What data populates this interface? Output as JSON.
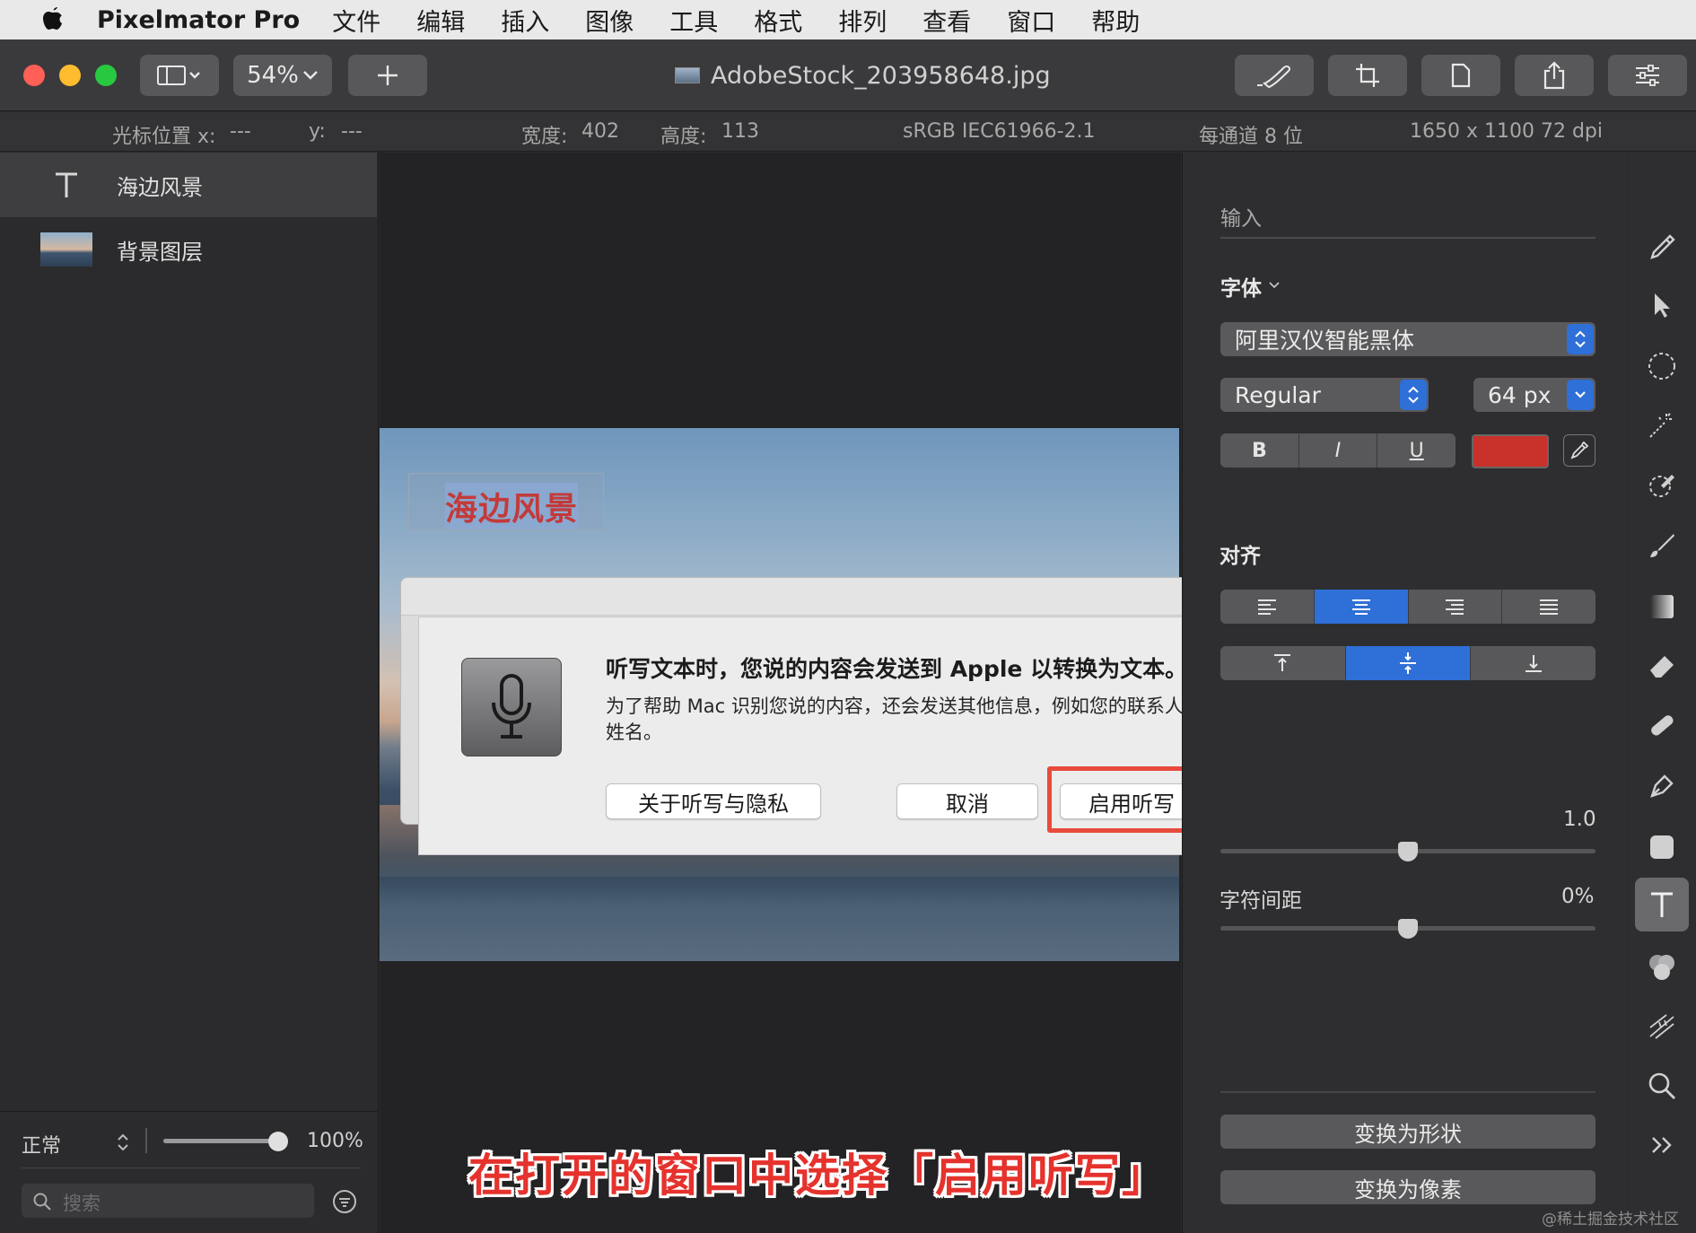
{
  "menubar": {
    "app_name": "Pixelmator Pro",
    "items": [
      "文件",
      "编辑",
      "插入",
      "图像",
      "工具",
      "格式",
      "排列",
      "查看",
      "窗口",
      "帮助"
    ]
  },
  "toolbar": {
    "zoom": "54%",
    "document_title": "AdobeStock_203958648.jpg"
  },
  "infobar": {
    "cursor_x_label": "光标位置 x:",
    "cursor_x_value": "---",
    "cursor_y_label": "y:",
    "cursor_y_value": "---",
    "width_label": "宽度:",
    "width_value": "402",
    "height_label": "高度:",
    "height_value": "113",
    "color_profile": "sRGB IEC61966-2.1",
    "bit_depth": "每通道 8 位",
    "dimensions": "1650 x 1100 72 dpi"
  },
  "layers": {
    "items": [
      {
        "name": "海边风景",
        "type": "text"
      },
      {
        "name": "背景图层",
        "type": "image"
      }
    ],
    "blend_mode": "正常",
    "opacity": "100%",
    "opacity_fraction": 1.0,
    "search_placeholder": "搜索"
  },
  "canvas": {
    "text_layer_content": "海边风景"
  },
  "dialog": {
    "title": "听写文本时，您说的内容会发送到 Apple 以转换为文本。",
    "body": "为了帮助 Mac 识别您说的内容，还会发送其他信息，例如您的联系人的姓名。",
    "about_button": "关于听写与隐私",
    "cancel_button": "取消",
    "enable_button": "启用听写"
  },
  "caption": "在打开的窗口中选择「启用听写」",
  "inspector": {
    "input_label": "输入",
    "font_section": "字体",
    "font_name": "阿里汉仪智能黑体",
    "font_style": "Regular",
    "font_size": "64 px",
    "bold": "B",
    "italic": "I",
    "underline": "U",
    "text_color": "#c8322a",
    "align_section": "对齐",
    "line_spacing_value": "1.0",
    "line_spacing_fraction": 0.5,
    "char_spacing_label": "字符间距",
    "char_spacing_value": "0%",
    "char_spacing_fraction": 0.5,
    "convert_shape": "变换为形状",
    "convert_pixels": "变换为像素"
  },
  "watermark": "@稀土掘金技术社区"
}
